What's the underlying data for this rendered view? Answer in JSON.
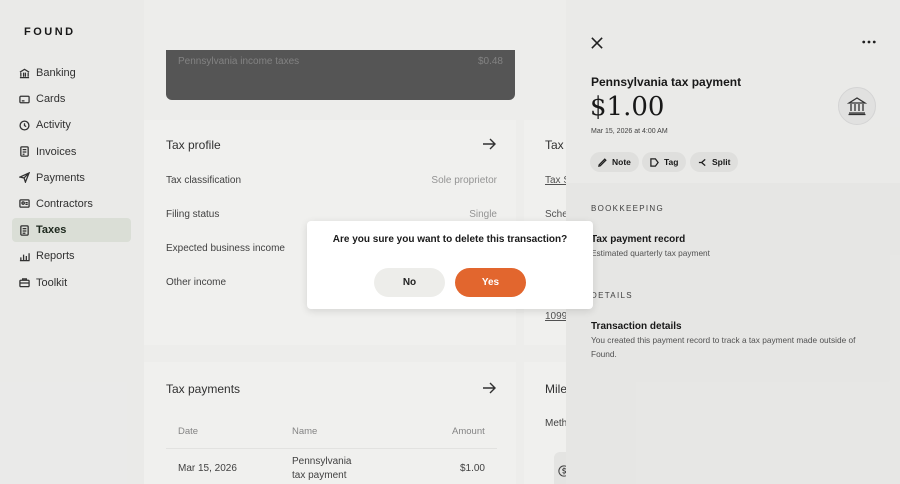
{
  "brand": "FOUND",
  "sidebar": {
    "items": [
      {
        "label": "Banking",
        "icon": "bank-icon"
      },
      {
        "label": "Cards",
        "icon": "card-icon"
      },
      {
        "label": "Activity",
        "icon": "clock-icon"
      },
      {
        "label": "Invoices",
        "icon": "invoice-icon"
      },
      {
        "label": "Payments",
        "icon": "send-icon"
      },
      {
        "label": "Contractors",
        "icon": "contractor-icon"
      },
      {
        "label": "Taxes",
        "icon": "taxes-icon",
        "active": true
      },
      {
        "label": "Reports",
        "icon": "reports-icon"
      },
      {
        "label": "Toolkit",
        "icon": "toolkit-icon"
      }
    ]
  },
  "main": {
    "dark_card": {
      "label": "Pennsylvania income taxes",
      "value": "$0.48"
    },
    "tax_profile": {
      "title": "Tax profile",
      "rows": [
        {
          "label": "Tax classification",
          "value": "Sole proprietor"
        },
        {
          "label": "Filing status",
          "value": "Single"
        },
        {
          "label": "Expected business income",
          "value": ""
        },
        {
          "label": "Other income",
          "value": ""
        }
      ]
    },
    "tax_docs": {
      "title_partial": "Tax d",
      "row1": "Tax S",
      "row2": "Sche",
      "row3": "1099"
    },
    "tax_payments": {
      "title": "Tax payments",
      "headers": {
        "date": "Date",
        "name": "Name",
        "amount": "Amount"
      },
      "rows": [
        {
          "date": "Mar 15, 2026",
          "name_line1": "Pennsylvania",
          "name_line2": "tax payment",
          "amount": "$1.00"
        }
      ]
    },
    "mileage": {
      "title_partial": "Mile",
      "row1": "Meth"
    }
  },
  "panel": {
    "title": "Pennsylvania tax payment",
    "amount": "$1.00",
    "date": "Mar 15, 2026 at 4:00 AM",
    "actions": {
      "note": "Note",
      "tag": "Tag",
      "split": "Split"
    },
    "bookkeeping_label": "BOOKKEEPING",
    "record_title": "Tax payment record",
    "record_sub": "Estimated quarterly tax payment",
    "details_label": "DETAILS",
    "details_title": "Transaction details",
    "details_text": "You created this payment record to track a tax payment made outside of Found."
  },
  "dialog": {
    "message": "Are you sure you want to delete this transaction?",
    "no_label": "No",
    "yes_label": "Yes"
  },
  "colors": {
    "accent": "#e2662e",
    "active_nav": "#e3e8df"
  }
}
